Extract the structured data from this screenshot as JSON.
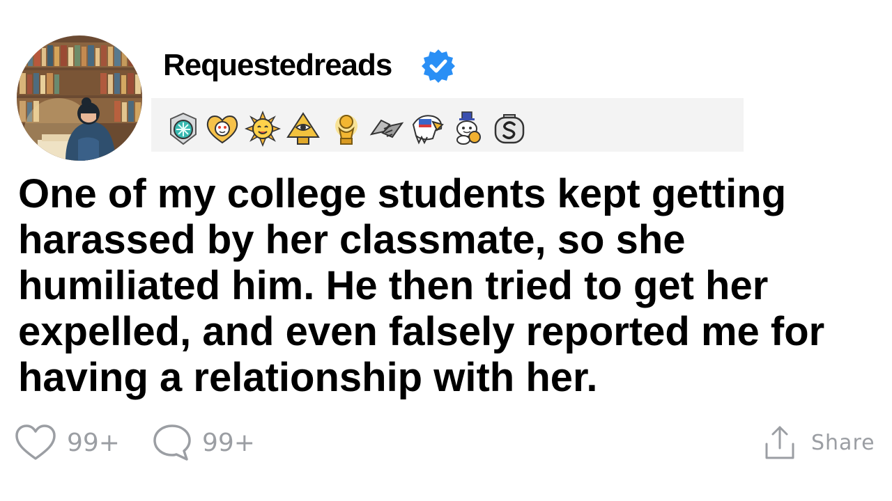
{
  "post": {
    "username": "Requestedreads",
    "verified": true,
    "title": "One of my college students kept getting harassed by her classmate, so she humiliated him. He then tried to get her expelled, and even falsely reported me for having a relationship with her.",
    "awards": [
      "silver-badge-award-icon",
      "wholesome-heart-award-icon",
      "sun-award-icon",
      "pyramid-eye-award-icon",
      "gold-trophy-award-icon",
      "handshake-award-icon",
      "eagle-award-icon",
      "snoo-mascot-award-icon",
      "s-coin-award-icon"
    ]
  },
  "actions": {
    "like_count": "99+",
    "comment_count": "99+",
    "share_label": "Share"
  },
  "colors": {
    "verified_blue": "#2a8ff5",
    "action_gray": "#9b9ea3",
    "awards_bar_bg": "#f3f3f3"
  }
}
